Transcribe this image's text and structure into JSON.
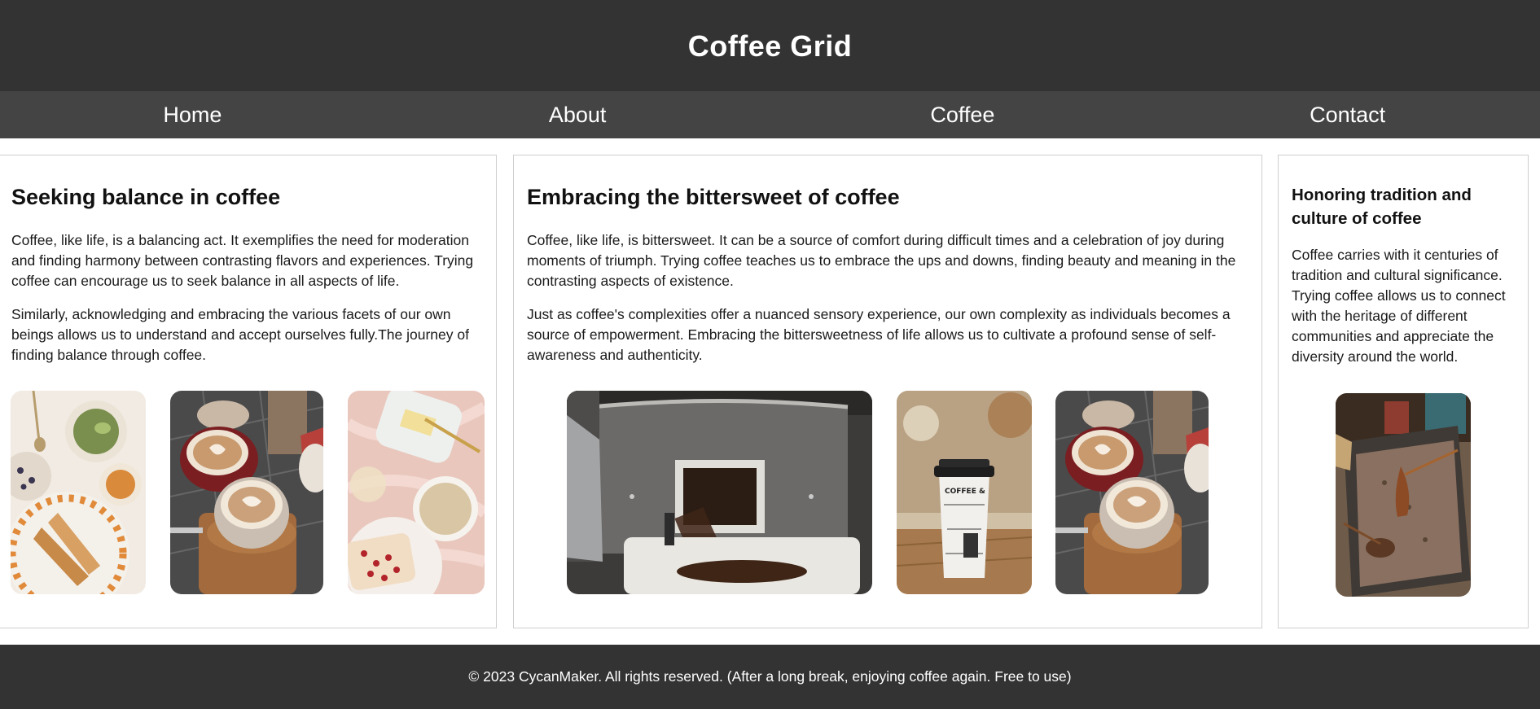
{
  "header": {
    "title": "Coffee Grid"
  },
  "nav": {
    "items": [
      "Home",
      "About",
      "Coffee",
      "Contact"
    ]
  },
  "cards": [
    {
      "title": "Seeking balance in coffee",
      "paragraphs": [
        "Coffee, like life, is a balancing act. It exemplifies the need for moderation and finding harmony between contrasting flavors and experiences. Trying coffee can encourage us to seek balance in all aspects of life.",
        "Similarly, acknowledging and embracing the various facets of our own beings allows us to understand and accept ourselves fully.The journey of finding balance through coffee."
      ],
      "images": [
        "breakfast-spread-photo",
        "latte-cups-photo",
        "butter-and-coffee-photo"
      ]
    },
    {
      "title": "Embracing the bittersweet of coffee",
      "paragraphs": [
        "Coffee, like life, is bittersweet. It can be a source of comfort during difficult times and a celebration of joy during moments of triumph. Trying coffee teaches us to embrace the ups and downs, finding beauty and meaning in the contrasting aspects of existence.",
        "Just as coffee's complexities offer a nuanced sensory experience, our own complexity as individuals becomes a source of empowerment. Embracing the bittersweetness of life allows us to cultivate a profound sense of self-awareness and authenticity."
      ],
      "images": [
        "coffee-roaster-photo",
        "takeaway-cup-photo",
        "latte-cups-photo"
      ],
      "cup_print": "COFFEE &"
    },
    {
      "title": "Honoring tradition and culture of coffee",
      "paragraphs": [
        "Coffee carries with it centuries of tradition and cultural significance. Trying coffee allows us to connect with the heritage of different communities and appreciate the diversity around the world."
      ],
      "images": [
        "sand-coffee-photo"
      ]
    }
  ],
  "footer": {
    "text": "© 2023 CycanMaker. All rights reserved. (After a long break, enjoying coffee again. Free to use)"
  },
  "colors": {
    "header_bg": "#333333",
    "nav_bg": "#444444",
    "footer_bg": "#333333",
    "text": "#111111",
    "card_border": "#cfcfcf"
  }
}
